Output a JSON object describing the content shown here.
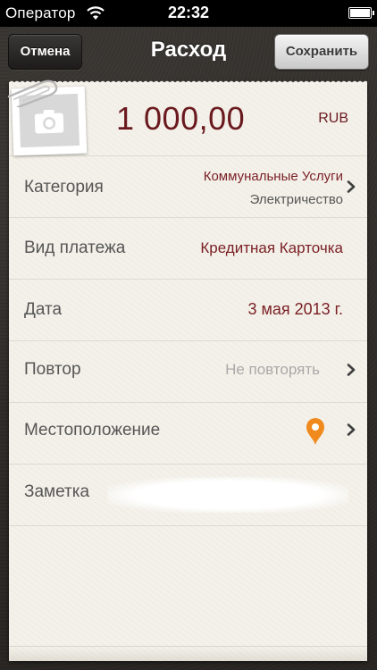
{
  "status_bar": {
    "carrier": "Оператор",
    "time": "22:32",
    "battery_level": 1.0
  },
  "nav": {
    "title": "Расход",
    "cancel_label": "Отмена",
    "save_label": "Сохранить"
  },
  "expense": {
    "amount": "1 000,00",
    "currency": "RUB"
  },
  "fields": {
    "category": {
      "label": "Категория",
      "value": "Коммунальные Услуги",
      "subvalue": "Электричество"
    },
    "payment_type": {
      "label": "Вид платежа",
      "value": "Кредитная Карточка"
    },
    "date": {
      "label": "Дата",
      "value": "3 мая 2013 г."
    },
    "repeat": {
      "label": "Повтор",
      "value": "Не повторять"
    },
    "location": {
      "label": "Местоположение"
    },
    "note": {
      "label": "Заметка",
      "value": ""
    }
  },
  "colors": {
    "accent": "#7a1f24",
    "paper": "#f4f1ea",
    "pin": "#f08a1c"
  },
  "icons": [
    "wifi-icon",
    "battery-icon",
    "camera-icon",
    "paperclip-icon",
    "chevron-right-icon",
    "map-pin-icon"
  ]
}
